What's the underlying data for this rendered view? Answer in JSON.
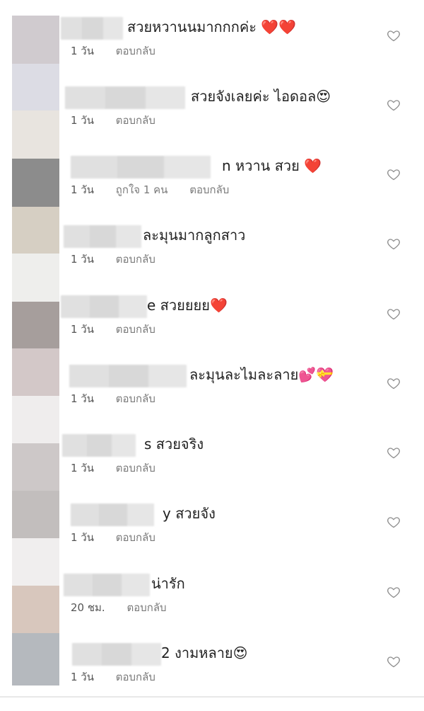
{
  "avatar_colors": [
    "#d0cbcf",
    "#dcdce4",
    "#e8e4df",
    "#8c8c8c",
    "#d6cfc3",
    "#eeeeec",
    "#a69e9c",
    "#d3c8c8",
    "#efeded",
    "#cdc8c8",
    "#c2bebd",
    "#f0eeee",
    "#d8c7bd",
    "#b5b9be"
  ],
  "colors": {
    "heart_red": "#e53945",
    "heart_pink": "#f06292",
    "emoji_yellow": "#f6c342",
    "text": "#222222",
    "meta": "#7a7a7a",
    "blur": "#dedede"
  },
  "comments": [
    {
      "text": "สวยหวานนมากกกค่ะ",
      "emoji": "❤️❤️",
      "time": "1 วัน",
      "likes": "",
      "reply": "ตอบกลับ"
    },
    {
      "text": "สวยจังเลยค่ะ ไอดอล",
      "emoji": "😍",
      "time": "1 วัน",
      "likes": "",
      "reply": "ตอบกลับ"
    },
    {
      "text": "n หวาน สวย",
      "emoji": "❤️",
      "time": "1 วัน",
      "likes": "ถูกใจ 1 คน",
      "reply": "ตอบกลับ"
    },
    {
      "text": "ละมุนมากลูกสาว",
      "emoji": "",
      "time": "1 วัน",
      "likes": "",
      "reply": "ตอบกลับ"
    },
    {
      "text": "e สวยยยย",
      "emoji": "❤️",
      "time": "1 วัน",
      "likes": "",
      "reply": "ตอบกลับ"
    },
    {
      "text": "ละมุนละไมละลาย",
      "emoji": "💕💝",
      "time": "1 วัน",
      "likes": "",
      "reply": "ตอบกลับ"
    },
    {
      "text": "s สวยจริง",
      "emoji": "",
      "time": "1 วัน",
      "likes": "",
      "reply": "ตอบกลับ"
    },
    {
      "text": "y สวยจัง",
      "emoji": "",
      "time": "1 วัน",
      "likes": "",
      "reply": "ตอบกลับ"
    },
    {
      "text": "น่ารัก",
      "emoji": "",
      "time": "20 ชม.",
      "likes": "",
      "reply": "ตอบกลับ"
    },
    {
      "text": "2 งามหลาย",
      "emoji": "😍",
      "time": "1 วัน",
      "likes": "",
      "reply": "ตอบกลับ"
    }
  ]
}
